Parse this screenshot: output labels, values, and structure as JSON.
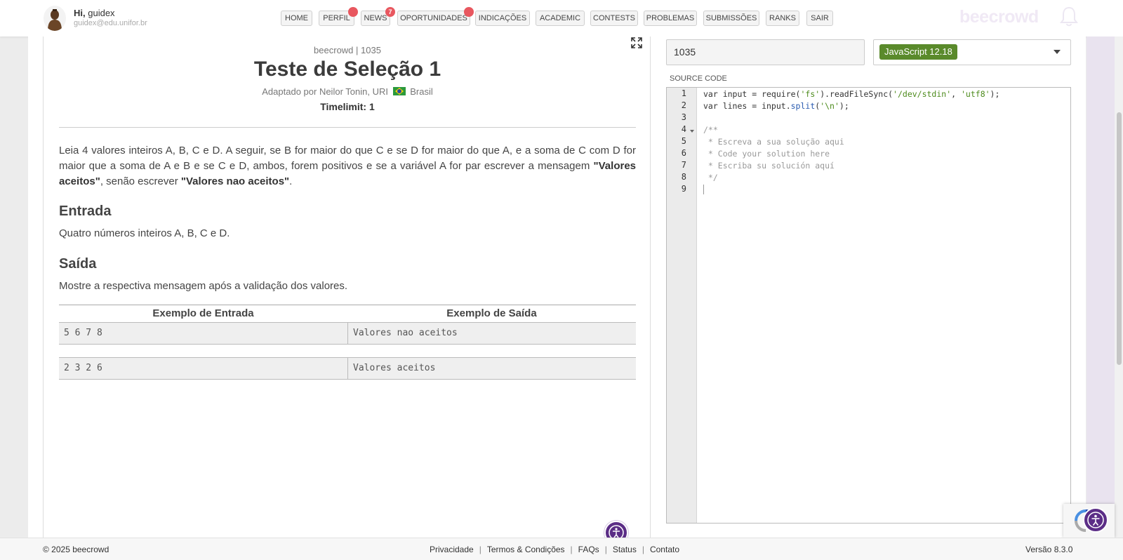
{
  "user": {
    "greeting": "Hi,",
    "name": "guidex",
    "email": "guidex@edu.unifor.br"
  },
  "nav": {
    "items": [
      {
        "label": "HOME"
      },
      {
        "label": "PERFIL"
      },
      {
        "label": "NEWS",
        "badge": "7"
      },
      {
        "label": "OPORTUNIDADES"
      },
      {
        "label": "INDICAÇÕES"
      },
      {
        "label": "ACADEMIC"
      },
      {
        "label": "CONTESTS"
      },
      {
        "label": "PROBLEMAS"
      },
      {
        "label": "SUBMISSÕES"
      },
      {
        "label": "RANKS"
      },
      {
        "label": "SAIR"
      }
    ],
    "brand": "beecrowd"
  },
  "problem": {
    "meta": "beecrowd | 1035",
    "title": "Teste de Seleção 1",
    "author_prefix": "Adaptado por Neilor Tonin, URI",
    "country": "Brasil",
    "timelimit": "Timelimit: 1",
    "description": {
      "part1": "Leia 4 valores inteiros A, B, C e D. A seguir, se B for maior do que C e se D for maior do que A, e a soma de C com D for maior que a soma de A e B e se C e D, ambos, forem positivos e se a variável A for par escrever a mensagem ",
      "bold1": "\"Valores aceitos\"",
      "part2": ", senão escrever ",
      "bold2": "\"Valores nao aceitos\"",
      "part3": "."
    },
    "input_heading": "Entrada",
    "input_text": "Quatro números inteiros A, B, C e D.",
    "output_heading": "Saída",
    "output_text": "Mostre a respectiva mensagem após a validação dos valores.",
    "table": {
      "header_in": "Exemplo de Entrada",
      "header_out": "Exemplo de Saída",
      "rows": [
        {
          "in": "5 6 7 8",
          "out": "Valores nao aceitos"
        },
        {
          "in": "2 3 2 6",
          "out": "Valores aceitos"
        }
      ]
    }
  },
  "editor": {
    "problem_id": "1035",
    "language": "JavaScript 12.18",
    "source_label": "SOURCE CODE",
    "line_numbers": [
      "1",
      "2",
      "3",
      "4",
      "5",
      "6",
      "7",
      "8",
      "9"
    ],
    "lines": {
      "l1a": "var input = require(",
      "l1b": "'fs'",
      "l1c": ").readFileSync(",
      "l1d": "'/dev/stdin'",
      "l1e": ", ",
      "l1f": "'utf8'",
      "l1g": ");",
      "l2a": "var lines = input.",
      "l2b": "split",
      "l2c": "(",
      "l2d": "'\\n'",
      "l2e": ");",
      "l4": "/**",
      "l5": " * Escreva a sua solução aqui",
      "l6": " * Code your solution here",
      "l7": " * Escriba su solución aquí",
      "l8": " */"
    }
  },
  "footer": {
    "copyright": "© 2025 beecrowd",
    "links": [
      "Privacidade",
      "Termos & Condições",
      "FAQs",
      "Status",
      "Contato"
    ],
    "version": "Versão 8.3.0"
  },
  "colors": {
    "badge": "#e8575f",
    "language_pill": "#5a8a2b",
    "accessibility": "#5b2d86",
    "string": "#4d8b1c"
  }
}
